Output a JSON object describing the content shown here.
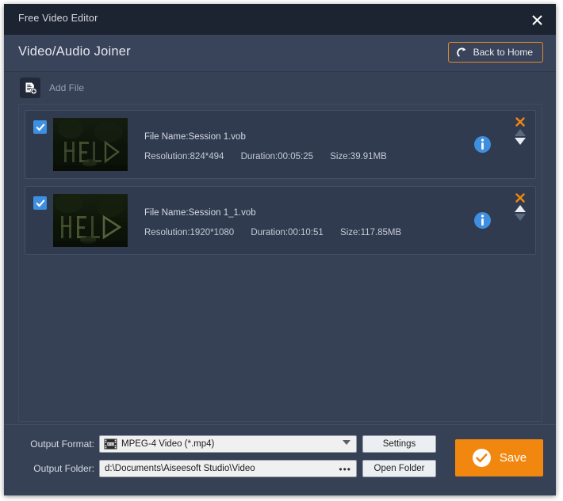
{
  "window": {
    "title": "Free Video Editor",
    "close_icon": "close-icon"
  },
  "header": {
    "page_title": "Video/Audio Joiner",
    "back_button": {
      "label": "Back to Home",
      "icon": "redo-arrow-icon",
      "border_color": "#e08a2a"
    }
  },
  "toolbar": {
    "add_file_label": "Add File",
    "add_file_icon": "add-file-icon"
  },
  "files": [
    {
      "checked": true,
      "file_name": "File Name:Session 1.vob",
      "resolution": "Resolution:824*494",
      "duration": "Duration:00:05:25",
      "size": "Size:39.91MB",
      "info_icon": "info-icon",
      "remove_icon": "remove-icon",
      "move_up_enabled": false,
      "move_down_enabled": true
    },
    {
      "checked": true,
      "file_name": "File Name:Session 1_1.vob",
      "resolution": "Resolution:1920*1080",
      "duration": "Duration:00:10:51",
      "size": "Size:117.85MB",
      "info_icon": "info-icon",
      "remove_icon": "remove-icon",
      "move_up_enabled": true,
      "move_down_enabled": false
    }
  ],
  "output": {
    "format_label": "Output Format:",
    "format_value": "MPEG-4 Video (*.mp4)",
    "format_icon": "mpeg-film-icon",
    "settings_label": "Settings",
    "folder_label": "Output Folder:",
    "folder_value": "d:\\Documents\\Aiseesoft Studio\\Video",
    "browse_label": "•••",
    "open_folder_label": "Open Folder"
  },
  "save": {
    "label": "Save",
    "icon": "check-circle-icon",
    "color": "#f2870f"
  },
  "colors": {
    "titlebar": "#1d2431",
    "header": "#39435a",
    "body": "#374155",
    "item": "#313b4f",
    "accent": "#f2870f",
    "checkbox": "#3f8fe0",
    "info": "#3f8fe0"
  }
}
